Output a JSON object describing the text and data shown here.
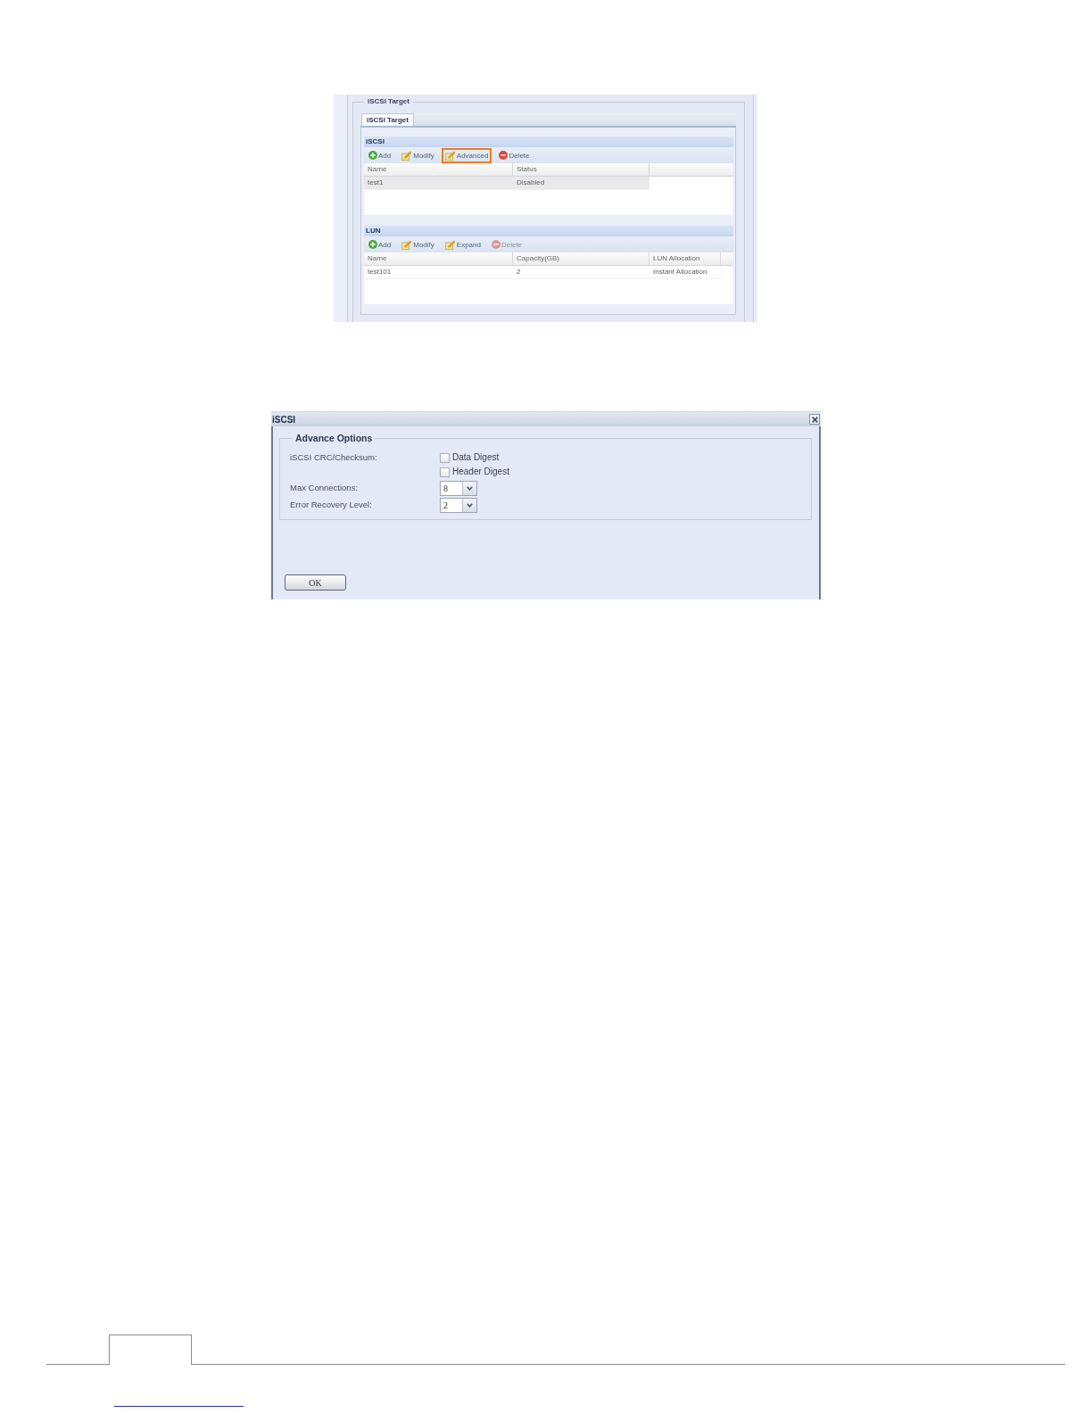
{
  "screenshot": {
    "group_title": "iSCSI Target",
    "tabs": [
      {
        "label": "iSCSI Target",
        "selected": true
      }
    ],
    "sections": [
      {
        "title": "iSCSI",
        "toolbar": [
          {
            "kind": "add",
            "label": "Add",
            "disabled": false,
            "highlighted": false
          },
          {
            "kind": "edit",
            "label": "Modify",
            "disabled": false,
            "highlighted": false
          },
          {
            "kind": "edit",
            "label": "Advanced",
            "disabled": false,
            "highlighted": true
          },
          {
            "kind": "delete",
            "label": "Delete",
            "disabled": false,
            "highlighted": false
          }
        ],
        "table": {
          "columns": [
            "Name",
            "Status"
          ],
          "rows": [
            {
              "cells": [
                "test1",
                "Disabled"
              ],
              "selected": true
            }
          ]
        }
      },
      {
        "title": "LUN",
        "toolbar": [
          {
            "kind": "add",
            "label": "Add",
            "disabled": false,
            "highlighted": false
          },
          {
            "kind": "edit",
            "label": "Modify",
            "disabled": false,
            "highlighted": false
          },
          {
            "kind": "edit",
            "label": "Expand",
            "disabled": false,
            "highlighted": false
          },
          {
            "kind": "delete",
            "label": "Delete",
            "disabled": true,
            "highlighted": false
          }
        ],
        "table": {
          "columns": [
            "Name",
            "Capacity(GB)",
            "LUN Allocation"
          ],
          "rows": [
            {
              "cells": [
                "test101",
                "2",
                "Instant Allocation"
              ],
              "selected": false
            }
          ]
        }
      }
    ]
  },
  "dialog": {
    "title": "iSCSI",
    "group_title": "Advance Options",
    "fields": [
      {
        "kind": "checkboxes",
        "label": "iSCSI CRC/Checksum:",
        "options": [
          {
            "label": "Data Digest",
            "checked": false
          },
          {
            "label": "Header Digest",
            "checked": false
          }
        ]
      },
      {
        "kind": "select",
        "label": "Max Connections:",
        "value": "8"
      },
      {
        "kind": "select",
        "label": "Error Recovery Level:",
        "value": "2"
      }
    ],
    "buttons": [
      "OK"
    ]
  }
}
